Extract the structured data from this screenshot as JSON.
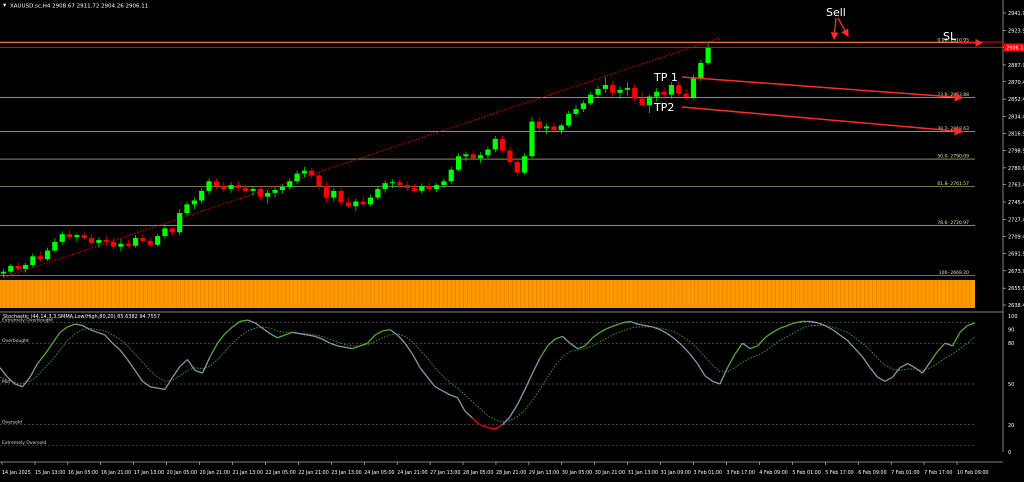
{
  "header": {
    "symbol_info": "XAUUSD.sc,H4  2908.67 2911.72 2904.26 2906.11"
  },
  "indicator": {
    "title": "Stochastic (44,14,3,3,SMMA,Low/High,80,20) 85.6382 94.7557",
    "levels": [
      {
        "label": "Extremely Overbought",
        "value": 95
      },
      {
        "label": "Overbought",
        "value": 80
      },
      {
        "label": "Mid",
        "value": 50
      },
      {
        "label": "Oversold",
        "value": 20
      },
      {
        "label": "Extremely Oversold",
        "value": 5
      }
    ],
    "axis_ticks": [
      "100",
      "90",
      "80",
      "50",
      "20",
      "0"
    ]
  },
  "annotations": {
    "sell": "Sell",
    "sl": "SL",
    "tp1": "TP 1",
    "tp2": "TP2"
  },
  "colors": {
    "background": "#000000",
    "bull": "#00ff00",
    "bear": "#ff0000",
    "fib": "#e6e6a0",
    "resistance": "#ff0000",
    "arrow": "#ff2a2a",
    "volume": "#ff9900",
    "stoch_main": "#8c95a8",
    "stoch_signal": "#33aa33",
    "stoch_main_up": "#55aa33"
  },
  "chart_data": [
    {
      "type": "candlestick",
      "price_axis_ticks": [
        "2941.90",
        "2923.90",
        "2905.90",
        "2887.90",
        "2870.40",
        "2852.40",
        "2834.40",
        "2816.90",
        "2798.90",
        "2780.90",
        "2763.40",
        "2745.40",
        "2727.40",
        "2709.40",
        "2691.90",
        "2673.90",
        "2655.90",
        "2638.40"
      ],
      "time_axis_ticks": [
        "14 Jan 2025",
        "15 Jan 13:00",
        "16 Jan 05:00",
        "16 Jan 21:00",
        "17 Jan 13:00",
        "20 Jan 05:00",
        "20 Jan 21:00",
        "21 Jan 13:00",
        "22 Jan 05:00",
        "22 Jan 21:00",
        "23 Jan 13:00",
        "24 Jan 05:00",
        "24 Jan 21:00",
        "27 Jan 13:00",
        "28 Jan 05:00",
        "28 Jan 21:00",
        "29 Jan 13:00",
        "30 Jan 05:00",
        "30 Jan 21:00",
        "31 Jan 13:00",
        "31 Jan 09:00",
        "3 Feb 01:00",
        "3 Feb 17:00",
        "4 Feb 09:00",
        "5 Feb 01:00",
        "5 Feb 17:00",
        "6 Feb 09:00",
        "7 Feb 01:00",
        "7 Feb 17:00",
        "10 Feb 09:00"
      ],
      "ylim": [
        2638.4,
        2945
      ],
      "current_price": "2906.11",
      "sl_levels": [
        2911.7,
        2906.1
      ],
      "fib_levels": [
        {
          "label": "0.00- 2910.95",
          "value": 2910.95
        },
        {
          "label": "23.6- 2853.88",
          "value": 2853.88
        },
        {
          "label": "38.2- 2818.63",
          "value": 2818.63
        },
        {
          "label": "50.0- 2790.09",
          "value": 2790.09
        },
        {
          "label": "61.8- 2761.57",
          "value": 2761.57
        },
        {
          "label": "78.6- 2720.97",
          "value": 2720.97
        },
        {
          "label": "100- 2669.20",
          "value": 2669.2
        }
      ],
      "candles": [
        [
          2671,
          2676,
          2667,
          2673
        ],
        [
          2673,
          2681,
          2670,
          2679
        ],
        [
          2679,
          2683,
          2674,
          2676
        ],
        [
          2676,
          2682,
          2672,
          2680
        ],
        [
          2680,
          2692,
          2678,
          2689
        ],
        [
          2689,
          2694,
          2683,
          2686
        ],
        [
          2686,
          2698,
          2684,
          2695
        ],
        [
          2695,
          2708,
          2693,
          2704
        ],
        [
          2704,
          2715,
          2701,
          2712
        ],
        [
          2712,
          2716,
          2706,
          2709
        ],
        [
          2709,
          2713,
          2704,
          2711
        ],
        [
          2711,
          2715,
          2706,
          2708
        ],
        [
          2708,
          2712,
          2701,
          2703
        ],
        [
          2703,
          2709,
          2698,
          2706
        ],
        [
          2706,
          2710,
          2700,
          2704
        ],
        [
          2704,
          2708,
          2696,
          2699
        ],
        [
          2699,
          2707,
          2694,
          2702
        ],
        [
          2702,
          2706,
          2697,
          2700
        ],
        [
          2700,
          2711,
          2698,
          2708
        ],
        [
          2708,
          2712,
          2703,
          2705
        ],
        [
          2705,
          2709,
          2699,
          2701
        ],
        [
          2701,
          2712,
          2699,
          2710
        ],
        [
          2710,
          2722,
          2707,
          2718
        ],
        [
          2718,
          2720,
          2710,
          2714
        ],
        [
          2714,
          2738,
          2711,
          2734
        ],
        [
          2734,
          2746,
          2731,
          2743
        ],
        [
          2743,
          2750,
          2738,
          2747
        ],
        [
          2747,
          2760,
          2744,
          2757
        ],
        [
          2757,
          2770,
          2753,
          2767
        ],
        [
          2767,
          2770,
          2759,
          2762
        ],
        [
          2762,
          2766,
          2756,
          2759
        ],
        [
          2759,
          2766,
          2755,
          2763
        ],
        [
          2763,
          2767,
          2757,
          2760
        ],
        [
          2760,
          2764,
          2754,
          2757
        ],
        [
          2757,
          2762,
          2752,
          2759
        ],
        [
          2759,
          2762,
          2747,
          2751
        ],
        [
          2751,
          2758,
          2744,
          2755
        ],
        [
          2755,
          2761,
          2750,
          2758
        ],
        [
          2758,
          2764,
          2754,
          2761
        ],
        [
          2761,
          2770,
          2758,
          2767
        ],
        [
          2767,
          2778,
          2764,
          2775
        ],
        [
          2775,
          2782,
          2771,
          2778
        ],
        [
          2778,
          2781,
          2770,
          2773
        ],
        [
          2773,
          2776,
          2758,
          2762
        ],
        [
          2762,
          2766,
          2745,
          2750
        ],
        [
          2750,
          2760,
          2746,
          2757
        ],
        [
          2757,
          2760,
          2741,
          2745
        ],
        [
          2745,
          2750,
          2739,
          2741
        ],
        [
          2741,
          2749,
          2736,
          2746
        ],
        [
          2746,
          2752,
          2740,
          2743
        ],
        [
          2743,
          2753,
          2741,
          2750
        ],
        [
          2750,
          2762,
          2748,
          2759
        ],
        [
          2759,
          2768,
          2755,
          2765
        ],
        [
          2765,
          2769,
          2760,
          2766
        ],
        [
          2766,
          2769,
          2760,
          2763
        ],
        [
          2763,
          2767,
          2757,
          2760
        ],
        [
          2760,
          2764,
          2755,
          2757
        ],
        [
          2757,
          2765,
          2754,
          2762
        ],
        [
          2762,
          2766,
          2756,
          2759
        ],
        [
          2759,
          2765,
          2756,
          2763
        ],
        [
          2763,
          2770,
          2760,
          2767
        ],
        [
          2767,
          2782,
          2764,
          2779
        ],
        [
          2779,
          2796,
          2777,
          2793
        ],
        [
          2793,
          2798,
          2788,
          2795
        ],
        [
          2795,
          2799,
          2789,
          2791
        ],
        [
          2791,
          2797,
          2786,
          2794
        ],
        [
          2794,
          2803,
          2791,
          2800
        ],
        [
          2800,
          2814,
          2797,
          2811
        ],
        [
          2811,
          2814,
          2796,
          2799
        ],
        [
          2799,
          2803,
          2784,
          2787
        ],
        [
          2787,
          2791,
          2772,
          2776
        ],
        [
          2776,
          2796,
          2774,
          2793
        ],
        [
          2793,
          2834,
          2791,
          2829
        ],
        [
          2829,
          2833,
          2818,
          2822
        ],
        [
          2822,
          2827,
          2816,
          2824
        ],
        [
          2824,
          2828,
          2818,
          2820
        ],
        [
          2820,
          2827,
          2816,
          2825
        ],
        [
          2825,
          2840,
          2823,
          2837
        ],
        [
          2837,
          2846,
          2834,
          2842
        ],
        [
          2842,
          2851,
          2839,
          2848
        ],
        [
          2848,
          2860,
          2846,
          2857
        ],
        [
          2857,
          2866,
          2854,
          2863
        ],
        [
          2863,
          2875,
          2859,
          2867
        ],
        [
          2867,
          2871,
          2855,
          2859
        ],
        [
          2859,
          2866,
          2853,
          2862
        ],
        [
          2862,
          2870,
          2856,
          2864
        ],
        [
          2864,
          2868,
          2850,
          2853
        ],
        [
          2853,
          2860,
          2845,
          2846
        ],
        [
          2846,
          2857,
          2838,
          2855
        ],
        [
          2855,
          2864,
          2850,
          2860
        ],
        [
          2860,
          2865,
          2852,
          2857
        ],
        [
          2857,
          2870,
          2853,
          2867
        ],
        [
          2867,
          2871,
          2853,
          2858
        ],
        [
          2858,
          2863,
          2851,
          2854
        ],
        [
          2854,
          2878,
          2852,
          2874
        ],
        [
          2874,
          2893,
          2871,
          2890
        ],
        [
          2890,
          2911,
          2888,
          2906
        ]
      ]
    },
    {
      "type": "line",
      "name": "Stochastic",
      "ylim": [
        0,
        100
      ],
      "main": [
        62,
        55,
        50,
        48,
        55,
        65,
        72,
        80,
        88,
        92,
        94,
        93,
        90,
        88,
        86,
        80,
        75,
        68,
        60,
        52,
        48,
        47,
        46,
        55,
        63,
        68,
        60,
        58,
        70,
        80,
        87,
        92,
        96,
        97,
        95,
        91,
        87,
        84,
        86,
        88,
        87,
        86,
        85,
        83,
        80,
        78,
        77,
        76,
        78,
        80,
        86,
        89,
        90,
        86,
        80,
        72,
        62,
        55,
        48,
        45,
        42,
        40,
        30,
        25,
        20,
        18,
        17,
        20,
        26,
        35,
        46,
        58,
        69,
        78,
        83,
        85,
        80,
        76,
        78,
        84,
        88,
        91,
        93,
        95,
        96,
        94,
        93,
        92,
        90,
        87,
        83,
        78,
        72,
        65,
        56,
        52,
        50,
        62,
        72,
        80,
        76,
        78,
        84,
        88,
        91,
        93,
        95,
        96,
        96,
        95,
        93,
        90,
        86,
        82,
        76,
        70,
        62,
        55,
        52,
        55,
        62,
        65,
        62,
        58,
        66,
        74,
        80,
        78,
        88,
        93,
        95
      ],
      "signal": [
        55,
        53,
        51,
        50,
        52,
        56,
        62,
        68,
        75,
        82,
        87,
        90,
        91,
        90,
        89,
        86,
        83,
        78,
        72,
        66,
        60,
        55,
        52,
        53,
        56,
        60,
        62,
        61,
        63,
        68,
        74,
        80,
        85,
        89,
        91,
        92,
        91,
        89,
        88,
        88,
        87,
        87,
        86,
        85,
        83,
        81,
        79,
        78,
        78,
        79,
        81,
        84,
        86,
        87,
        85,
        81,
        75,
        69,
        62,
        56,
        51,
        47,
        42,
        37,
        32,
        27,
        24,
        22,
        23,
        26,
        31,
        38,
        46,
        55,
        63,
        70,
        74,
        75,
        76,
        78,
        81,
        84,
        87,
        89,
        91,
        92,
        92,
        92,
        91,
        90,
        88,
        85,
        81,
        76,
        70,
        64,
        59,
        59,
        62,
        66,
        69,
        71,
        74,
        78,
        82,
        85,
        88,
        91,
        93,
        93,
        93,
        92,
        90,
        88,
        84,
        80,
        75,
        69,
        64,
        61,
        60,
        61,
        61,
        60,
        62,
        65,
        69,
        72,
        76,
        80,
        85
      ]
    }
  ]
}
